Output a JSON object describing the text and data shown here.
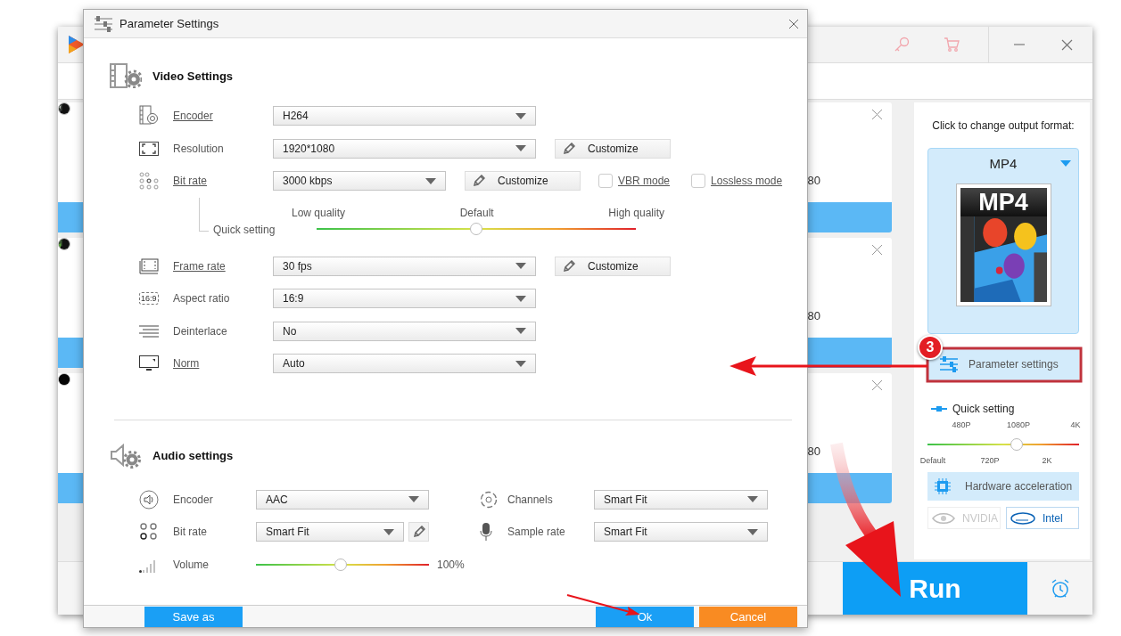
{
  "app_window": {
    "cards": [
      {
        "resolution_tail": "80"
      },
      {
        "resolution_tail": "80"
      },
      {
        "resolution_tail": "80"
      }
    ],
    "output_panel": {
      "prompt": "Click to change output format:",
      "format": "MP4",
      "format_badge": "MP4",
      "parameter_button": "Parameter settings",
      "quick_setting": {
        "label": "Quick setting",
        "level": 0.59,
        "top_marks": [
          "480P",
          "1080P",
          "4K"
        ],
        "bottom_marks": [
          "Default",
          "720P",
          "2K"
        ]
      },
      "hardware_button": "Hardware acceleration",
      "gpus": [
        {
          "label": "NVIDIA",
          "disabled": true
        },
        {
          "label": "Intel",
          "disabled": false
        }
      ]
    },
    "run_button": "Run"
  },
  "dialog": {
    "title": "Parameter Settings",
    "video_settings": {
      "heading": "Video Settings",
      "rows": [
        {
          "kind": "select",
          "label": "Encoder",
          "link": true,
          "value": "H264"
        },
        {
          "kind": "select",
          "label": "Resolution",
          "link": false,
          "value": "1920*1080",
          "customize": "Customize"
        },
        {
          "kind": "select",
          "label": "Bit rate",
          "link": true,
          "value": "3000 kbps",
          "customize": "Customize",
          "options": [
            {
              "label": "VBR mode",
              "checked": false
            },
            {
              "label": "Lossless mode",
              "checked": false
            }
          ]
        },
        {
          "kind": "slider",
          "label": "Quick setting",
          "marks": [
            "Low quality",
            "Default",
            "High quality"
          ],
          "level": 0.5
        },
        {
          "kind": "select",
          "label": "Frame rate",
          "link": true,
          "value": "30 fps",
          "customize": "Customize"
        },
        {
          "kind": "select",
          "label": "Aspect ratio",
          "link": false,
          "value": "16:9",
          "icon_label": "16:9"
        },
        {
          "kind": "select",
          "label": "Deinterlace",
          "link": false,
          "value": "No"
        },
        {
          "kind": "select",
          "label": "Norm",
          "link": true,
          "value": "Auto"
        }
      ]
    },
    "audio_settings": {
      "heading": "Audio settings",
      "rows": [
        {
          "left": {
            "kind": "select",
            "label": "Encoder",
            "value": "AAC",
            "edit_button": false
          },
          "right": {
            "label": "Channels",
            "value": "Smart Fit"
          }
        },
        {
          "left": {
            "kind": "select",
            "label": "Bit rate",
            "value": "Smart Fit",
            "edit_button": true
          },
          "right": {
            "label": "Sample rate",
            "value": "Smart Fit"
          }
        },
        {
          "left": {
            "kind": "slider",
            "label": "Volume",
            "level": 0.49,
            "reading": "100%"
          }
        }
      ]
    },
    "buttons": [
      {
        "label": "Save as",
        "kind": "save"
      },
      {
        "label": "Ok",
        "kind": "ok"
      },
      {
        "label": "Cancel",
        "kind": "cancel"
      }
    ]
  },
  "annotations": {
    "step_badge": "3"
  }
}
